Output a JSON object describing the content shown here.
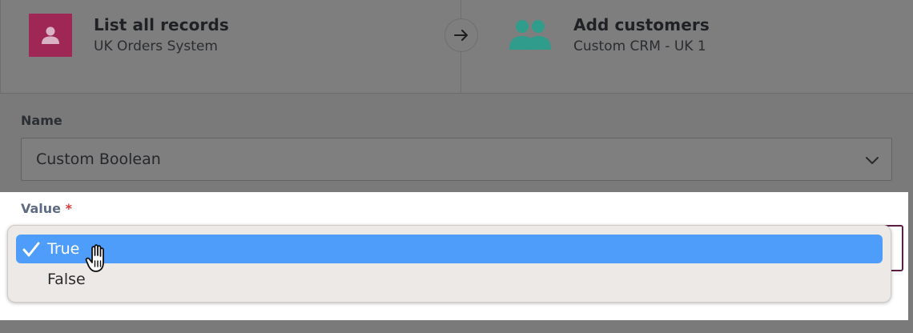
{
  "steps": {
    "source": {
      "title": "List all records",
      "subtitle": "UK Orders System",
      "icon": "user-icon",
      "icon_color": "#9e2756"
    },
    "connector_icon": "arrow-right-icon",
    "target": {
      "title": "Add customers",
      "subtitle": "Custom CRM - UK 1",
      "icon": "people-icon",
      "icon_color": "#2fa08f"
    }
  },
  "form": {
    "name": {
      "label": "Name",
      "value": "Custom Boolean"
    },
    "value": {
      "label": "Value",
      "required_marker": "*",
      "options": [
        {
          "label": "True",
          "selected": true
        },
        {
          "label": "False",
          "selected": false
        }
      ]
    }
  },
  "colors": {
    "highlight": "#4f9dfa",
    "focus_border": "#5a1e4b",
    "required": "#d93a3a"
  }
}
